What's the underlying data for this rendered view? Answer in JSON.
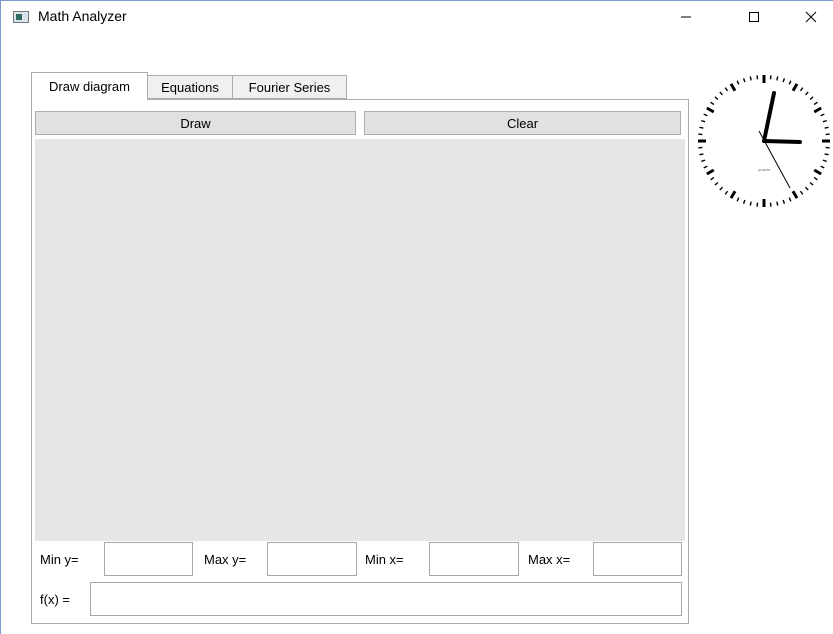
{
  "window": {
    "title": "Math Analyzer",
    "controls": {
      "minimize": "—",
      "maximize": "☐",
      "close": "✕"
    }
  },
  "tabs": [
    {
      "label": "Draw diagram",
      "active": true
    },
    {
      "label": "Equations",
      "active": false
    },
    {
      "label": "Fourier Series",
      "active": false
    }
  ],
  "toolbar": {
    "draw_label": "Draw",
    "clear_label": "Clear"
  },
  "range": {
    "min_y_label": "Min y=",
    "max_y_label": "Max y=",
    "min_x_label": "Min x=",
    "max_x_label": "Max x=",
    "min_y_value": "",
    "max_y_value": "",
    "min_x_value": "",
    "max_x_value": ""
  },
  "function": {
    "label": "f(x) =",
    "value": ""
  },
  "clock": {
    "face_text": "QUARTZ"
  },
  "colors": {
    "canvas": "#e6e6e6",
    "button": "#e1e1e1",
    "border": "#acacac"
  }
}
